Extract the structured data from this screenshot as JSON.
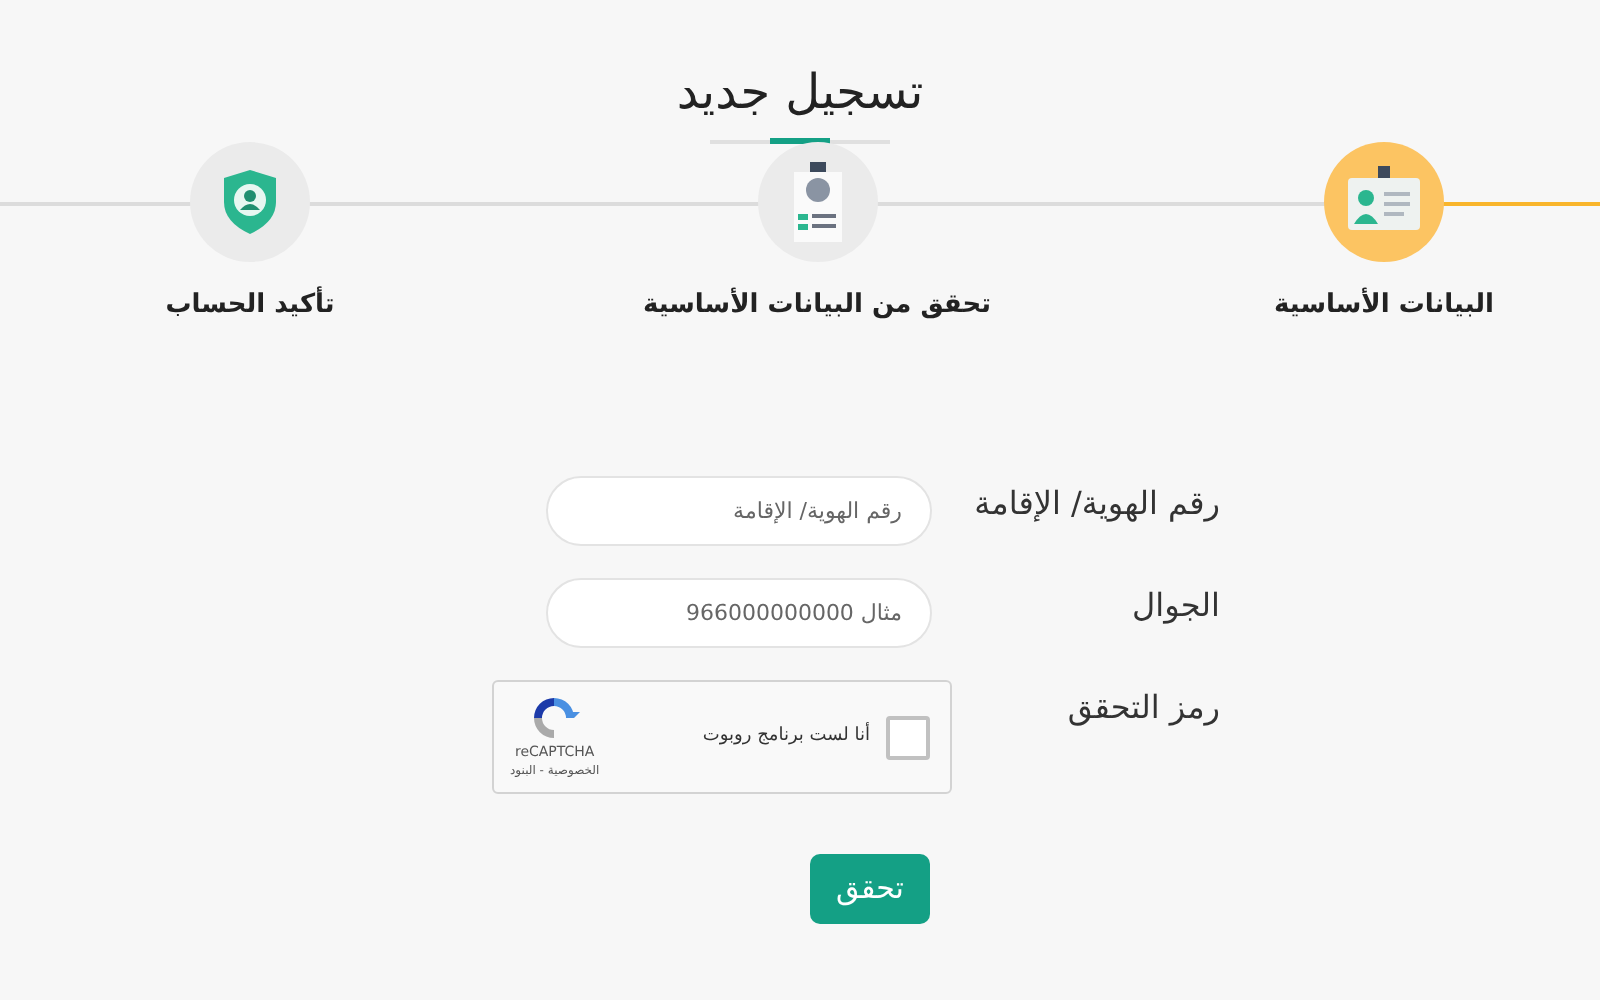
{
  "title": "تسجيل جديد",
  "steps": [
    {
      "label": "البيانات الأساسية",
      "selected": true,
      "kind": "card"
    },
    {
      "label": "تحقق من البيانات الأساسية",
      "selected": false,
      "kind": "badge"
    },
    {
      "label": "تأكيد الحساب",
      "selected": false,
      "kind": "shield"
    }
  ],
  "fields": [
    {
      "label": "رقم الهوية/ الإقامة",
      "placeholder": "رقم الهوية/ الإقامة"
    },
    {
      "label": "الجوال",
      "placeholder": "مثال 966000000000"
    }
  ],
  "captcha": {
    "label": "رمز التحقق",
    "checkbox_label": "أنا لست برنامج روبوت",
    "checked": false,
    "brand": "reCAPTCHA",
    "links": "الخصوصية - البنود"
  },
  "button": "تحقق"
}
